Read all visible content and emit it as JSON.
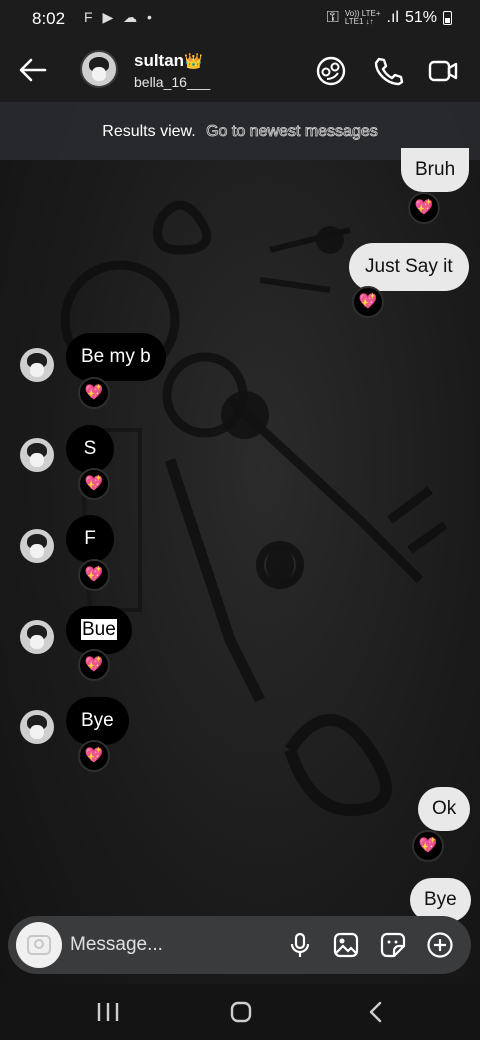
{
  "status_bar": {
    "time": "8:02",
    "left_icons": "F ▶ ☁ •",
    "network": "Vo)) LTE+",
    "network2": "LTE1 ↓↑",
    "signal": ".ıl",
    "battery": "51%"
  },
  "header": {
    "name": "sultan",
    "crown": "👑",
    "username": "bella_16___"
  },
  "banner": {
    "text": "Results view.",
    "link": "Go to newest messages"
  },
  "messages": {
    "out_1": "Bruh",
    "out_2": "Just Say it",
    "in_1": "Be my b",
    "in_2": "S",
    "in_3": "F",
    "in_4": "Bue",
    "in_5": "Bye",
    "out_3": "Ok",
    "out_4": "Bye"
  },
  "reaction_icon": "💖",
  "composer": {
    "placeholder": "Message..."
  },
  "icons": {
    "back": "arrow-left-icon",
    "header_actions": [
      "sticker-face-icon",
      "phone-icon",
      "video-camera-icon"
    ],
    "composer_actions": [
      "microphone-icon",
      "image-icon",
      "sticker-icon",
      "plus-circle-icon"
    ],
    "nav": [
      "recents-icon",
      "home-icon",
      "back-nav-icon"
    ]
  },
  "colors": {
    "outgoing_bubble": "#e9e9ea",
    "incoming_bubble": "#000000",
    "reaction": "#ff4fa3",
    "crown": "#f2b531"
  }
}
